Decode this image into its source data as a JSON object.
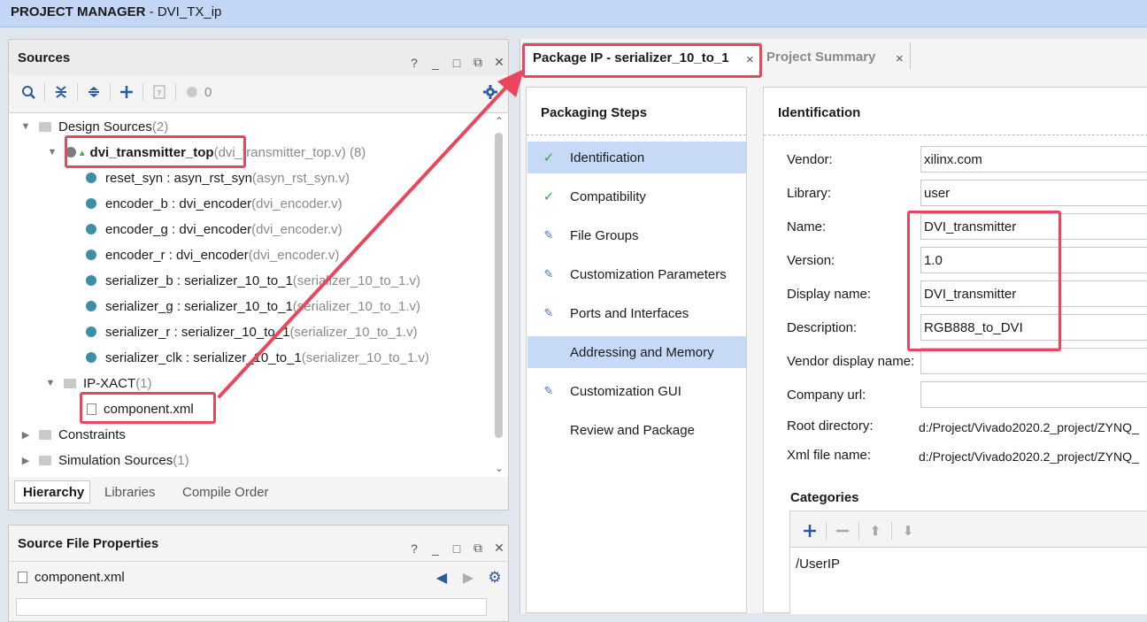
{
  "title_bar": {
    "app": "PROJECT MANAGER",
    "project": " - DVI_TX_ip"
  },
  "sources": {
    "title": "Sources",
    "header_icons": [
      "?",
      "_",
      "□",
      "⧉",
      "✕"
    ],
    "error_count": "0",
    "tree": [
      {
        "label": "Design Sources",
        "suffix": " (2)"
      },
      {
        "label": "dvi_transmitter_top",
        "suffix": " (dvi_transmitter_top.v) (8)"
      },
      {
        "label": "reset_syn : asyn_rst_syn",
        "suffix": " (asyn_rst_syn.v)"
      },
      {
        "label": "encoder_b : dvi_encoder",
        "suffix": " (dvi_encoder.v)"
      },
      {
        "label": "encoder_g : dvi_encoder",
        "suffix": " (dvi_encoder.v)"
      },
      {
        "label": "encoder_r : dvi_encoder",
        "suffix": " (dvi_encoder.v)"
      },
      {
        "label": "serializer_b : serializer_10_to_1",
        "suffix": " (serializer_10_to_1.v)"
      },
      {
        "label": "serializer_g : serializer_10_to_1",
        "suffix": " (serializer_10_to_1.v)"
      },
      {
        "label": "serializer_r : serializer_10_to_1",
        "suffix": " (serializer_10_to_1.v)"
      },
      {
        "label": "serializer_clk : serializer_10_to_1",
        "suffix": " (serializer_10_to_1.v)"
      },
      {
        "label": "IP-XACT",
        "suffix": " (1)"
      },
      {
        "label": "component.xml",
        "suffix": ""
      },
      {
        "label": "Constraints",
        "suffix": ""
      },
      {
        "label": "Simulation Sources",
        "suffix": " (1)"
      }
    ],
    "bottom_tabs": [
      "Hierarchy",
      "Libraries",
      "Compile Order"
    ]
  },
  "source_file_props": {
    "title": "Source File Properties",
    "file": "component.xml"
  },
  "editor_tabs": [
    {
      "label": "Package IP - serializer_10_to_1",
      "close": "×"
    },
    {
      "label": "Project Summary",
      "close": "×"
    }
  ],
  "packaging_steps": {
    "title": "Packaging Steps",
    "items": [
      {
        "label": "Identification",
        "icon": "check"
      },
      {
        "label": "Compatibility",
        "icon": "check"
      },
      {
        "label": "File Groups",
        "icon": "edit"
      },
      {
        "label": "Customization Parameters",
        "icon": "edit"
      },
      {
        "label": "Ports and Interfaces",
        "icon": "edit"
      },
      {
        "label": "Addressing and Memory",
        "icon": "none"
      },
      {
        "label": "Customization GUI",
        "icon": "edit"
      },
      {
        "label": "Review and Package",
        "icon": "none"
      }
    ]
  },
  "identification": {
    "title": "Identification",
    "fields": [
      {
        "label": "Vendor:",
        "value": "xilinx.com"
      },
      {
        "label": "Library:",
        "value": "user"
      },
      {
        "label": "Name:",
        "value": "DVI_transmitter"
      },
      {
        "label": "Version:",
        "value": "1.0"
      },
      {
        "label": "Display name:",
        "value": "DVI_transmitter"
      },
      {
        "label": "Description:",
        "value": "RGB888_to_DVI"
      },
      {
        "label": "Vendor display name:",
        "value": ""
      },
      {
        "label": "Company url:",
        "value": ""
      }
    ],
    "root_dir_label": "Root directory:",
    "root_dir": "d:/Project/Vivado2020.2_project/ZYNQ_",
    "xml_label": "Xml file name:",
    "xml_file": "d:/Project/Vivado2020.2_project/ZYNQ_",
    "categories_title": "Categories",
    "category_item": "/UserIP"
  },
  "colors": {
    "highlight": "#e8475d",
    "selection": "#c6daf7",
    "accent": "#2c5a9c"
  }
}
